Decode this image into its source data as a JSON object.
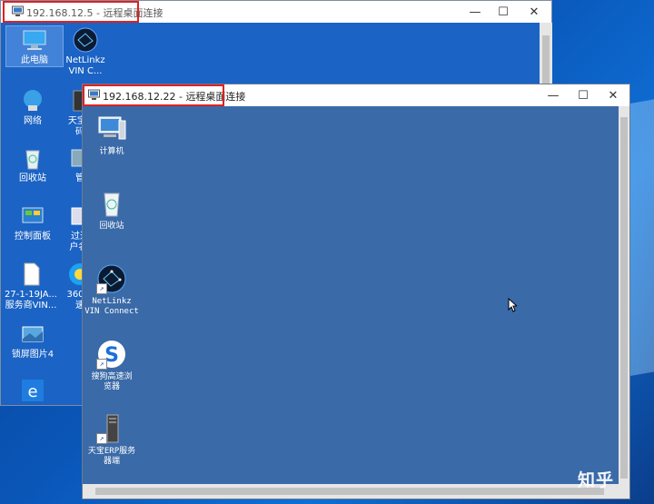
{
  "outer_window": {
    "title": "192.168.12.5 - 远程桌面连接",
    "controls": {
      "minimize": "—",
      "maximize": "☐",
      "close": "✕"
    },
    "icons": [
      {
        "label": "此电脑"
      },
      {
        "label": "NetLinkz\nVIN C..."
      },
      {
        "label": "网络"
      },
      {
        "label": "天宝E\n码"
      },
      {
        "label": "回收站"
      },
      {
        "label": "管"
      },
      {
        "label": "控制面板"
      },
      {
        "label": "过道\n户名:"
      },
      {
        "label": "27-1-19JA...\n服务商VIN..."
      },
      {
        "label": "360极\n速"
      },
      {
        "label": "锁屏图片4"
      },
      {
        "label": ""
      }
    ]
  },
  "inner_window": {
    "title": "192.168.12.22 - 远程桌面连接",
    "controls": {
      "minimize": "—",
      "maximize": "☐",
      "close": "✕"
    },
    "icons": [
      {
        "label": "计算机"
      },
      {
        "label": "回收站"
      },
      {
        "label": "NetLinkz\nVIN Connect"
      },
      {
        "label": "搜狗高速浏\n览器"
      },
      {
        "label": "天宝ERP服务\n器端"
      }
    ]
  },
  "watermark": "知乎",
  "colors": {
    "highlight": "#e02020",
    "inner_desktop": "#3a6aa8",
    "outer_desktop": "#1b63c4"
  }
}
